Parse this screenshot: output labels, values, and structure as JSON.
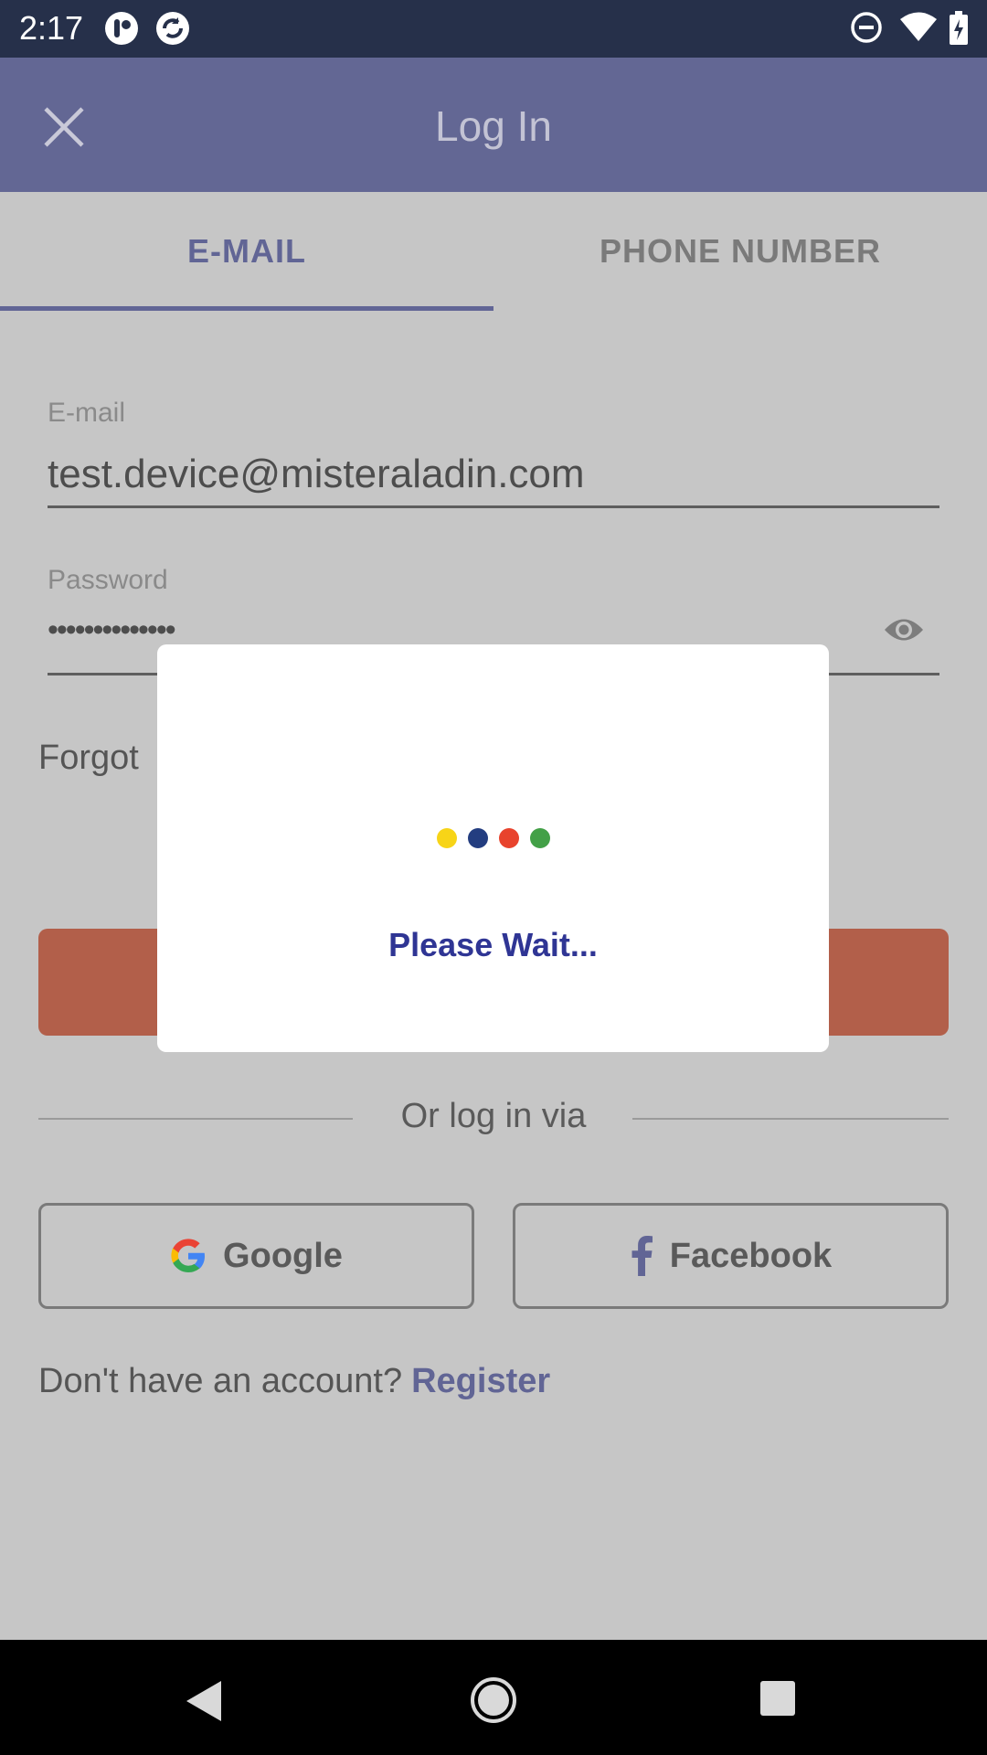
{
  "status_bar": {
    "time": "2:17",
    "icons": [
      "app-notification-icon",
      "sync-icon",
      "do-not-disturb-icon",
      "wifi-icon",
      "battery-icon"
    ]
  },
  "app_bar": {
    "title": "Log In",
    "close_icon": "close-icon",
    "bg_color": "#636794"
  },
  "tabs": [
    {
      "label": "E-MAIL",
      "selected": true
    },
    {
      "label": "PHONE NUMBER",
      "selected": false
    }
  ],
  "form": {
    "email_label": "E-mail",
    "email_value": "test.device@misteraladin.com",
    "password_label": "Password",
    "password_value": "••••••••••••••",
    "forgot_text": "Forgot"
  },
  "login_button": {
    "color": "#b25f4a"
  },
  "or_text": "Or log in via",
  "social": {
    "google_label": "Google",
    "facebook_label": "Facebook"
  },
  "register": {
    "prompt": "Don't have an account?",
    "link": "Register"
  },
  "modal": {
    "text": "Please Wait...",
    "dot_colors": [
      "#f7d417",
      "#233d80",
      "#e8432d",
      "#43a047"
    ]
  }
}
